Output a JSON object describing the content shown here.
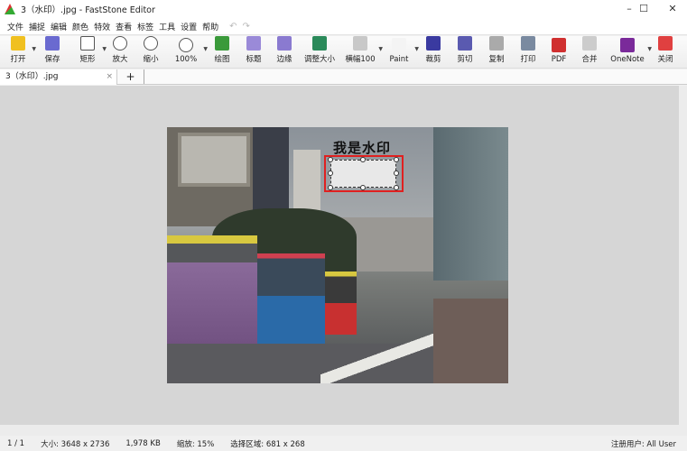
{
  "window": {
    "title": "3（水印）.jpg - FastStone Editor",
    "minimize": "–",
    "maximize": "☐",
    "close": "✕"
  },
  "menu": [
    "文件",
    "捕捉",
    "编辑",
    "颜色",
    "特效",
    "查看",
    "标签",
    "工具",
    "设置",
    "帮助"
  ],
  "undo": "↶",
  "redo": "↷",
  "toolbar": [
    {
      "label": "打开",
      "icon": "folder-open-icon",
      "color": "#f0c020",
      "dd": true
    },
    {
      "label": "保存",
      "icon": "save-icon",
      "color": "#6a6ad0"
    },
    {
      "label": "矩形",
      "icon": "rect-select-icon",
      "color": "#ffffff",
      "dd": true
    },
    {
      "label": "放大",
      "icon": "zoom-in-icon",
      "color": "#ffffff"
    },
    {
      "label": "缩小",
      "icon": "zoom-out-icon",
      "color": "#ffffff"
    },
    {
      "label": "100%",
      "icon": "zoom-100-icon",
      "color": "#ffffff",
      "dd": true
    },
    {
      "label": "绘图",
      "icon": "draw-icon",
      "color": "#3a9a3a"
    },
    {
      "label": "标题",
      "icon": "caption-icon",
      "color": "#9a8ad8"
    },
    {
      "label": "边缘",
      "icon": "edge-icon",
      "color": "#8a7ad0"
    },
    {
      "label": "调整大小",
      "icon": "resize-icon",
      "color": "#2a8a5a"
    },
    {
      "label": "横幅100",
      "icon": "banner-icon",
      "color": "#c8c8c8",
      "dd": true
    },
    {
      "label": "Paint",
      "icon": "paint-icon",
      "color": "#f4f4f4",
      "dd": true
    },
    {
      "label": "裁剪",
      "icon": "crop-icon",
      "color": "#3a3aa0"
    },
    {
      "label": "剪切",
      "icon": "cut-icon",
      "color": "#5a5ab0"
    },
    {
      "label": "复制",
      "icon": "copy-icon",
      "color": "#aaaaaa"
    },
    {
      "label": "打印",
      "icon": "print-icon",
      "color": "#7a8aa0"
    },
    {
      "label": "PDF",
      "icon": "pdf-icon",
      "color": "#d03030"
    },
    {
      "label": "合并",
      "icon": "merge-icon",
      "color": "#cccccc"
    },
    {
      "label": "OneNote",
      "icon": "onenote-icon",
      "color": "#7a2a9a",
      "dd": true
    },
    {
      "label": "关闭",
      "icon": "power-icon",
      "color": "#e04040"
    }
  ],
  "tab": {
    "label": "3（水印）.jpg",
    "close": "×",
    "add": "+"
  },
  "image": {
    "watermark": "我是水印"
  },
  "status": {
    "page": "1 / 1",
    "size": "大小:  3648 x 2736",
    "filesize": "1,978 KB",
    "zoom": "缩放:  15%",
    "selection": "选择区域:  681 x 268",
    "user": "注册用户:  All User"
  }
}
